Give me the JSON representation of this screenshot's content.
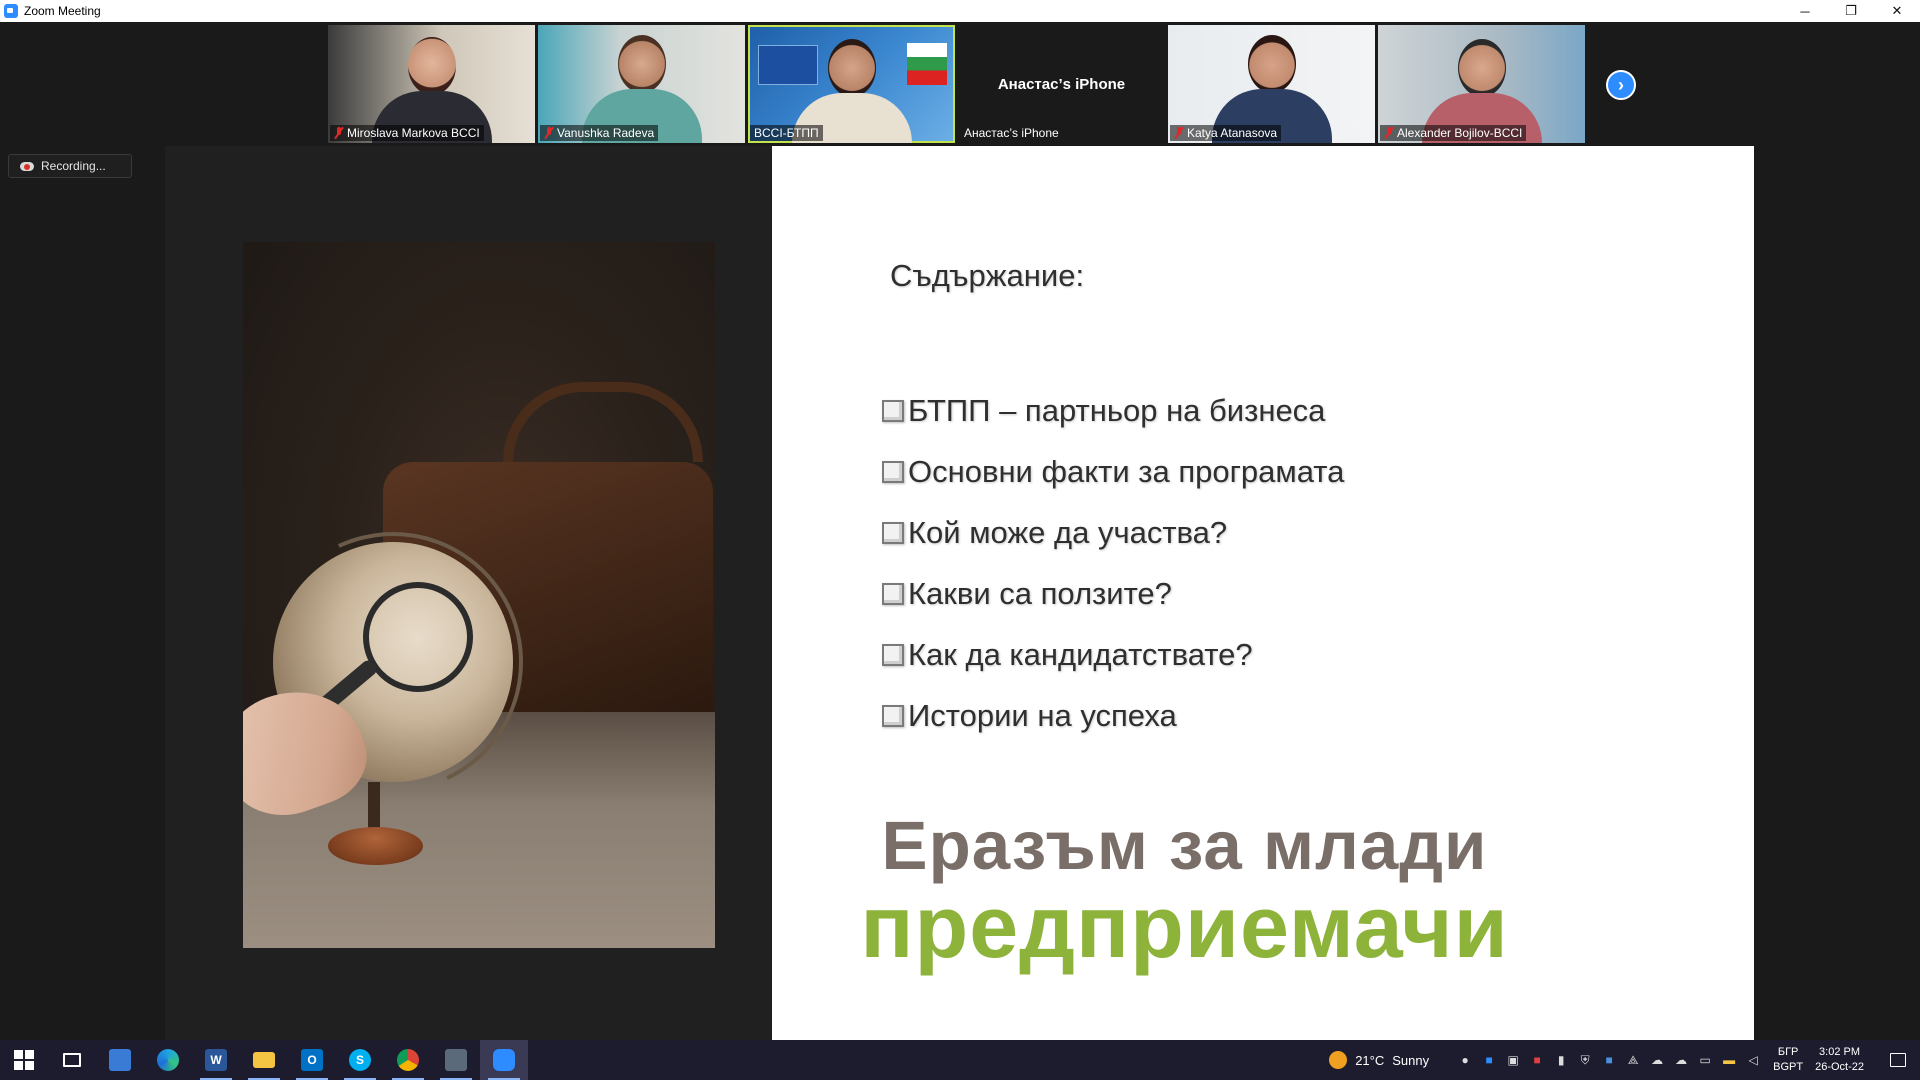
{
  "window": {
    "title": "Zoom Meeting",
    "minimize": "─",
    "restore": "❐",
    "close": "✕"
  },
  "participants": [
    {
      "name": "Miroslava Markova BCCI",
      "muted": true
    },
    {
      "name": "Vanushka Radeva",
      "muted": true
    },
    {
      "name": "BCCI-БТПП",
      "muted": false,
      "active": true
    },
    {
      "name": "Анастас’s iPhone",
      "display_name": "Анастас’s iPhone",
      "muted": false
    },
    {
      "name": "Katya Atanasova",
      "muted": true
    },
    {
      "name": "Alexander Bojilov-BCCI",
      "muted": true
    }
  ],
  "gallery_next": "›",
  "recording": {
    "label": "Recording..."
  },
  "slide": {
    "heading": "Съдържание:",
    "bullets": [
      "БТПП – партньор на бизнеса",
      "Основни факти за програмата",
      "Кой може да участва?",
      "Какви са ползите?",
      "Как да кандидатствате?",
      "Истории на успеха"
    ],
    "brand_line1": "Еразъм за млади",
    "brand_line2": "предприемачи",
    "colors": {
      "brand_gray": "#7a6e69",
      "brand_green": "#8db33b"
    }
  },
  "taskbar": {
    "apps": [
      "windows-start",
      "task-view",
      "store",
      "edge",
      "word",
      "file-explorer",
      "outlook",
      "skype",
      "chrome",
      "calculator",
      "zoom"
    ],
    "word_letter": "W",
    "outlook_letter": "O",
    "skype_letter": "S",
    "weather": {
      "temp": "21°C",
      "condition": "Sunny"
    },
    "language": {
      "top": "БГР",
      "bottom": "BGPT"
    },
    "clock": {
      "time": "3:02 PM",
      "date": "26-Oct-22"
    }
  }
}
